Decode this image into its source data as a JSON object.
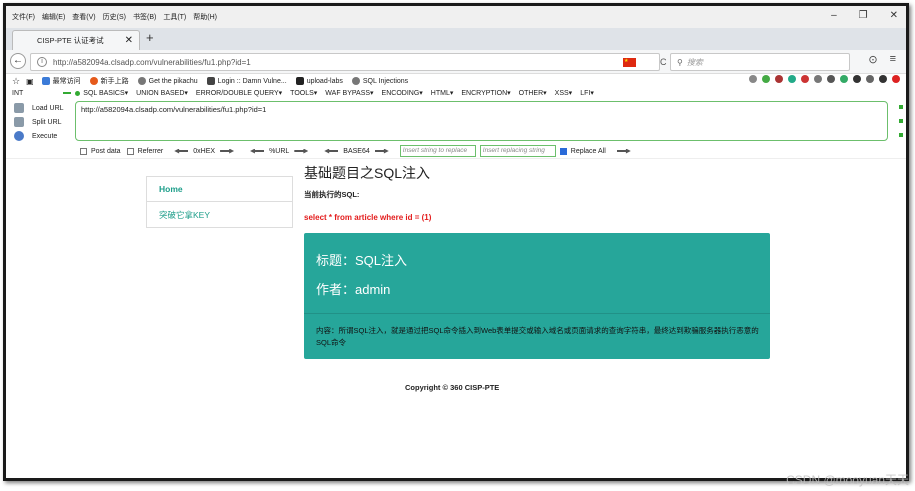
{
  "menu": [
    "文件(F)",
    "编辑(E)",
    "查看(V)",
    "历史(S)",
    "书签(B)",
    "工具(T)",
    "帮助(H)"
  ],
  "window_controls": [
    "–",
    "❐",
    "✕"
  ],
  "tab": {
    "title": "CISP-PTE 认证考试",
    "close": "✕",
    "new": "+"
  },
  "nav": {
    "url": "http://a582094a.clsadp.com/vulnerabilities/fu1.php?id=1",
    "search_placeholder": "搜索",
    "back": "←",
    "reload": "C",
    "right_icons": [
      "⊙",
      "≡"
    ]
  },
  "bookmarks": [
    {
      "label": "最常访问",
      "color": "#3b7bd8"
    },
    {
      "label": "新手上路",
      "color": "#e55a1b"
    },
    {
      "label": "Get the pikachu",
      "color": "#777"
    },
    {
      "label": "Login :: Damn Vulne...",
      "color": "#444"
    },
    {
      "label": "upload-labs",
      "color": "#222"
    },
    {
      "label": "SQL Injections",
      "color": "#777"
    }
  ],
  "hackbar_menu": {
    "select": "INT",
    "items": [
      "SQL BASICS▾",
      "UNION BASED▾",
      "ERROR/DOUBLE QUERY▾",
      "TOOLS▾",
      "WAF BYPASS▾",
      "ENCODING▾",
      "HTML▾",
      "ENCRYPTION▾",
      "OTHER▾",
      "XSS▾",
      "LFI▾"
    ]
  },
  "hackbar_actions": [
    "Load URL",
    "Split URL",
    "Execute"
  ],
  "hackbar_url": "http://a582094a.clsadp.com/vulnerabilities/fu1.php?id=1",
  "hackbar_options": {
    "post_data": "Post data",
    "referrer": "Referrer",
    "hex": "0xHEX",
    "url": "%URL",
    "base64": "BASE64",
    "find_placeholder": "Insert string to replace",
    "replace_placeholder": "Insert replacing string",
    "replace_all": "Replace All"
  },
  "sidebar": [
    {
      "label": "Home"
    },
    {
      "label": "突破它拿KEY"
    }
  ],
  "main": {
    "title": "基础题目之SQL注入",
    "sql_label": "当前执行的SQL:",
    "sql_query": "select * from article where id = (1)",
    "card_title": "标题：SQL注入",
    "card_author": "作者：admin",
    "card_content": "内容：所谓SQL注入，就是通过把SQL命令插入到Web表单提交或输入域名或页面请求的查询字符串，最终达到欺骗服务器执行恶意的SQL命令"
  },
  "footer": "Copyright © 360 CISP-PTE",
  "watermark": "CSDN @mooyuan天天",
  "colors": {
    "accent": "#26a69a",
    "link": "#1d9e8a",
    "sql": "#e31b1b",
    "hackbar_border": "#6cbf6c"
  }
}
